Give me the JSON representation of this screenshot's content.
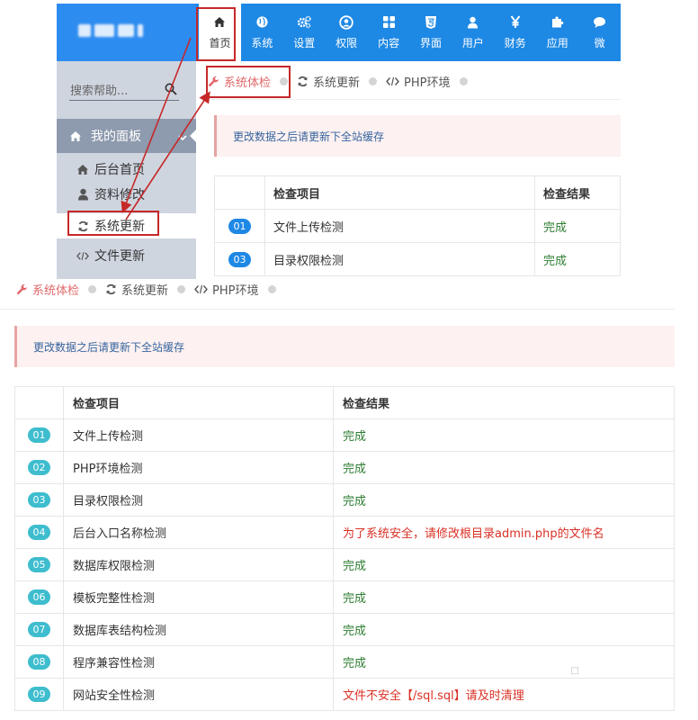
{
  "top": {
    "nav": [
      {
        "label": "首页",
        "icon": "home-icon",
        "active": true
      },
      {
        "label": "系统",
        "icon": "globe-icon"
      },
      {
        "label": "设置",
        "icon": "cogs-icon"
      },
      {
        "label": "权限",
        "icon": "user-circle-icon"
      },
      {
        "label": "内容",
        "icon": "grid-icon"
      },
      {
        "label": "界面",
        "icon": "html5-icon"
      },
      {
        "label": "用户",
        "icon": "user-icon"
      },
      {
        "label": "财务",
        "icon": "yen-icon"
      },
      {
        "label": "应用",
        "icon": "puzzle-icon"
      },
      {
        "label": "微",
        "icon": "chat-icon"
      }
    ],
    "search_placeholder": "搜索帮助...",
    "panel_label": "我的面板",
    "side_links": [
      {
        "label": "后台首页",
        "icon": "home-icon"
      },
      {
        "label": "资料修改",
        "icon": "user-icon"
      },
      {
        "label": "系统更新",
        "icon": "refresh-icon"
      },
      {
        "label": "文件更新",
        "icon": "code-icon"
      }
    ],
    "tabs": [
      {
        "label": "系统体检",
        "icon": "wrench-icon",
        "active": true
      },
      {
        "label": "系统更新",
        "icon": "refresh-icon"
      },
      {
        "label": "PHP环境",
        "icon": "code-icon"
      }
    ],
    "alert": "更改数据之后请更新下全站缓存",
    "table": {
      "headers": [
        "检查项目",
        "检查结果"
      ],
      "rows": [
        {
          "num": "01",
          "item": "文件上传检测",
          "result": "完成"
        },
        {
          "num": "03",
          "item": "目录权限检测",
          "result": "完成"
        }
      ]
    }
  },
  "bottom": {
    "tabs": [
      {
        "label": "系统体检",
        "icon": "wrench-icon",
        "active": true
      },
      {
        "label": "系统更新",
        "icon": "refresh-icon"
      },
      {
        "label": "PHP环境",
        "icon": "code-icon"
      }
    ],
    "alert": "更改数据之后请更新下全站缓存",
    "table": {
      "headers": [
        "检查项目",
        "检查结果"
      ],
      "rows": [
        {
          "num": "01",
          "item": "文件上传检测",
          "result": "完成",
          "status": "ok"
        },
        {
          "num": "02",
          "item": "PHP环境检测",
          "result": "完成",
          "status": "ok"
        },
        {
          "num": "03",
          "item": "目录权限检测",
          "result": "完成",
          "status": "ok"
        },
        {
          "num": "04",
          "item": "后台入口名称检测",
          "result": "为了系统安全，请修改根目录admin.php的文件名",
          "status": "warn"
        },
        {
          "num": "05",
          "item": "数据库权限检测",
          "result": "完成",
          "status": "ok"
        },
        {
          "num": "06",
          "item": "模板完整性检测",
          "result": "完成",
          "status": "ok"
        },
        {
          "num": "07",
          "item": "数据库表结构检测",
          "result": "完成",
          "status": "ok"
        },
        {
          "num": "08",
          "item": "程序兼容性检测",
          "result": "完成",
          "status": "ok"
        },
        {
          "num": "09",
          "item": "网站安全性检测",
          "result": "文件不安全【/sql.sql】请及时清理",
          "status": "warn"
        }
      ]
    }
  },
  "colors": {
    "header_blue": "#1e88e5",
    "logo_blue": "#2d8cf0",
    "sidebar_bg": "#cfd5df",
    "panel_bg": "#8e9aad",
    "badge_blue": "#1e88e5",
    "badge_teal": "#3ebdce",
    "ok_green": "#2e7d32",
    "warn_red": "#d93025",
    "annotation_red": "#c62828",
    "tab_active": "#e0686a"
  }
}
